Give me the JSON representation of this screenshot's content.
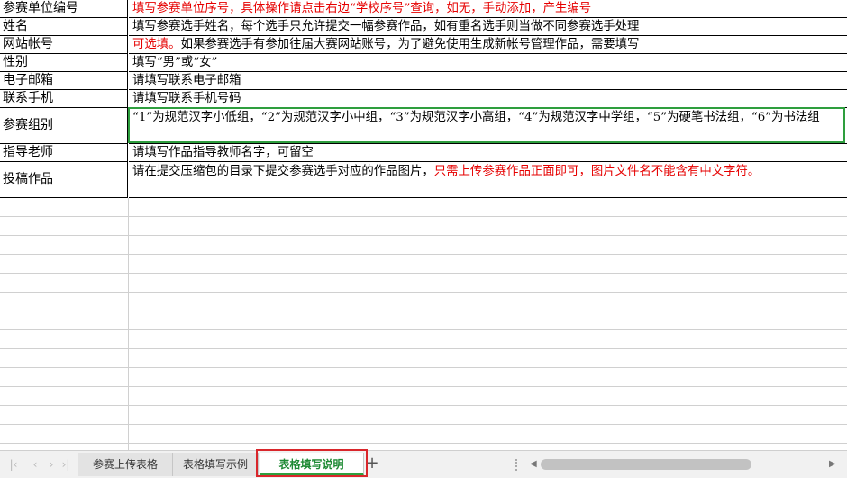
{
  "rows": [
    {
      "label": "参赛单位编号",
      "desc_black": "",
      "desc_red": "填写参赛单位序号，具体操作请点击右边“学校序号”查询，如无，手动添加，产生编号",
      "desc_after": ""
    },
    {
      "label": "姓名",
      "desc_black": "填写参赛选手姓名，每个选手只允许提交一幅参赛作品，如有重名选手则当做不同参赛选手处理",
      "desc_red": "",
      "desc_after": ""
    },
    {
      "label": "网站帐号",
      "desc_black": "",
      "desc_red": "可选填。",
      "desc_after": "如果参赛选手有参加往届大赛网站账号，为了避免使用生成新帐号管理作品，需要填写"
    },
    {
      "label": "性别",
      "desc_black": "填写“男”或“女”",
      "desc_red": "",
      "desc_after": ""
    },
    {
      "label": "电子邮箱",
      "desc_black": "请填写联系电子邮箱",
      "desc_red": "",
      "desc_after": ""
    },
    {
      "label": "联系手机",
      "desc_black": "请填写联系手机号码",
      "desc_red": "",
      "desc_after": ""
    },
    {
      "label": "参赛组别",
      "desc_black": "“1”为规范汉字小低组，“2”为规范汉字小中组，“3”为规范汉字小高组，“4”为规范汉字中学组，“5”为硬笔书法组，“6”为书法组",
      "desc_red": "",
      "desc_after": ""
    },
    {
      "label": "指导老师",
      "desc_black": "请填写作品指导教师名字，可留空",
      "desc_red": "",
      "desc_after": ""
    },
    {
      "label": "投稿作品",
      "desc_black": "请在提交压缩包的目录下提交参赛选手对应的作品图片，",
      "desc_red": "只需上传参赛作品正面即可，图片文件名不能含有中文字符。",
      "desc_after": ""
    }
  ],
  "tabs": {
    "tab1": "参赛上传表格",
    "tab2": "表格填写示例",
    "tab3": "表格填写说明",
    "add": "+"
  },
  "nav": {
    "first": "|‹",
    "prev": "‹",
    "next": "›",
    "last": "›|"
  },
  "scroll": {
    "left": "◀",
    "right": "▶"
  },
  "colors": {
    "red_text": "#e60000",
    "active_tab": "#1e8a34",
    "selection_border": "#2e9e3e",
    "highlight_box": "#d9262b"
  }
}
